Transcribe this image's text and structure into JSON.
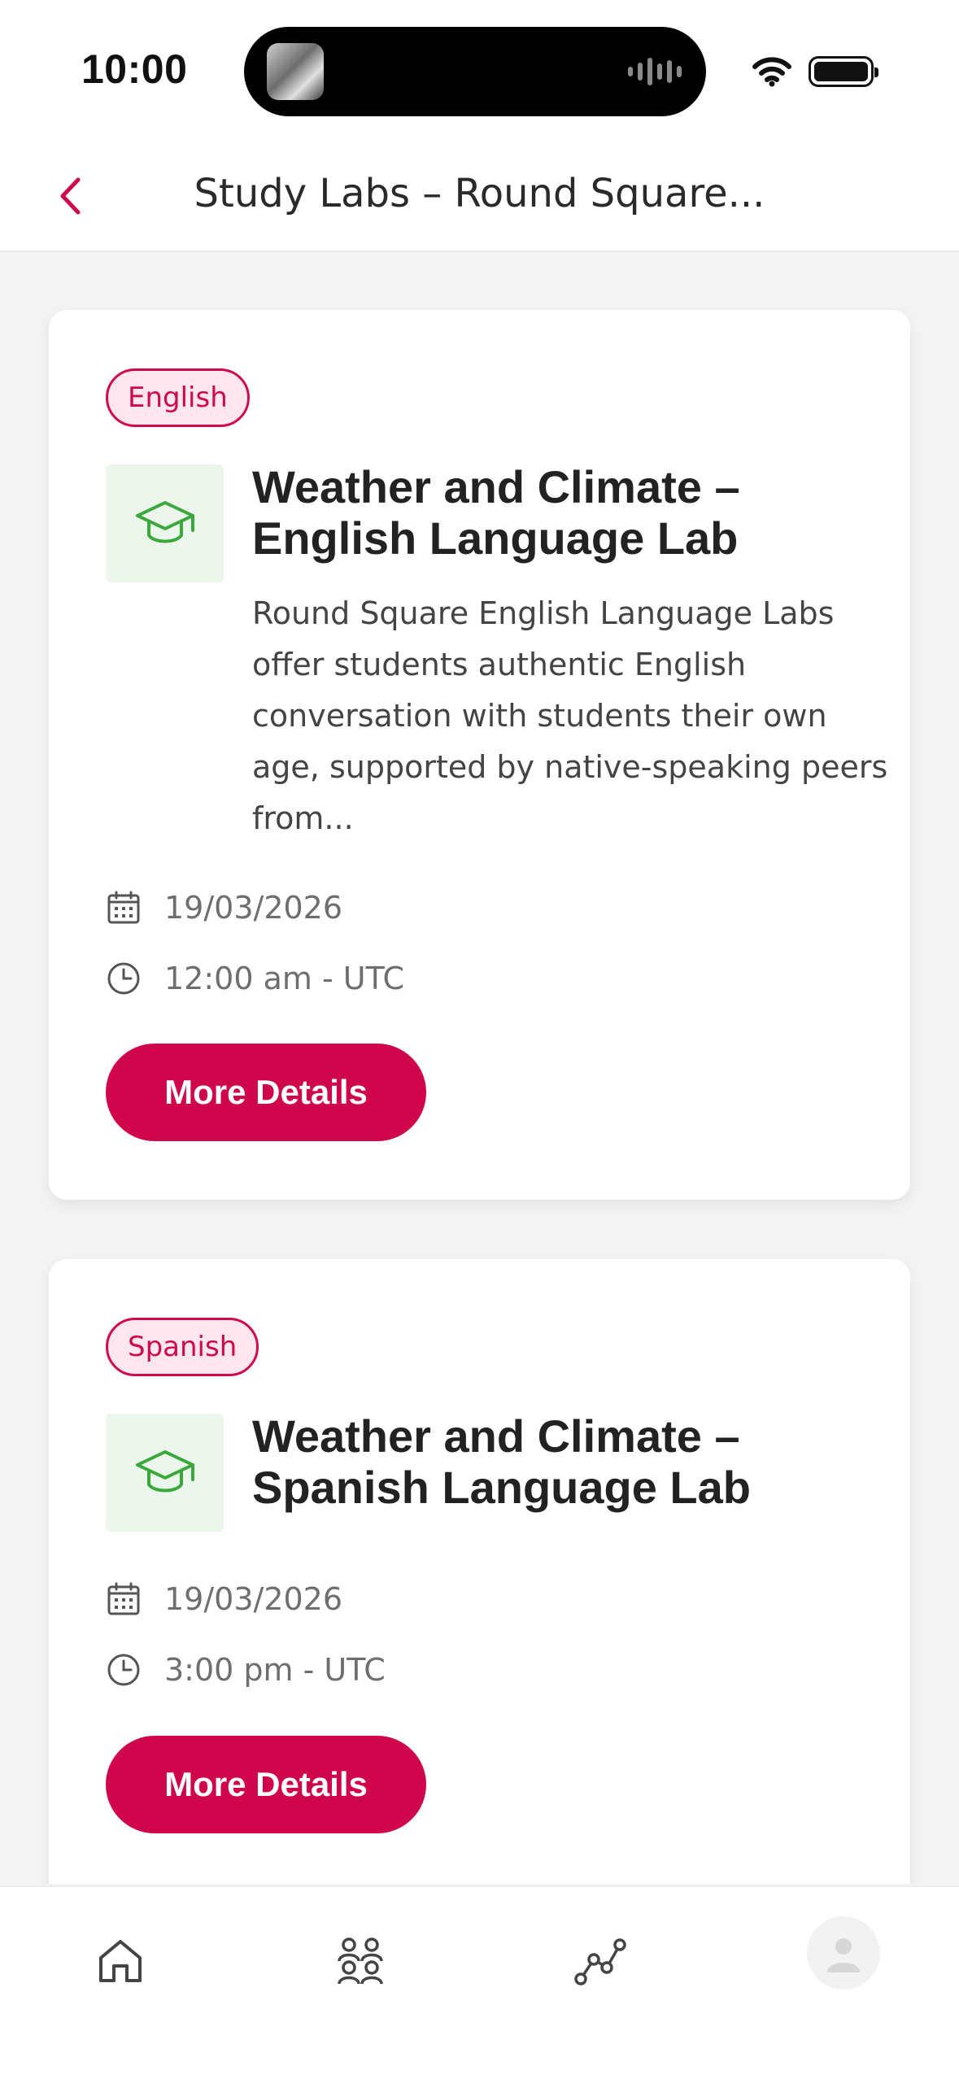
{
  "status_bar": {
    "time": "10:00"
  },
  "header": {
    "title": "Study Labs – Round Square..."
  },
  "cards": [
    {
      "tag": "English",
      "title": "Weather and Climate – English Language Lab",
      "description": "Round Square English Language Labs offer students authentic English conversation with students their own age, supported by native-speaking peers from...",
      "date": "19/03/2026",
      "time": "12:00 am - UTC",
      "button_label": "More Details"
    },
    {
      "tag": "Spanish",
      "title": "Weather and Climate – Spanish Language Lab",
      "date": "19/03/2026",
      "time": "3:00 pm - UTC",
      "button_label": "More Details"
    }
  ],
  "tab_bar": {
    "items": [
      "home-icon",
      "groups-icon",
      "progress-icon",
      "profile-avatar"
    ]
  },
  "colors": {
    "accent": "#d0064c",
    "tag_bg": "#fde6ee",
    "icon_green": "#3aa83a",
    "icon_box": "#edf6ec"
  }
}
